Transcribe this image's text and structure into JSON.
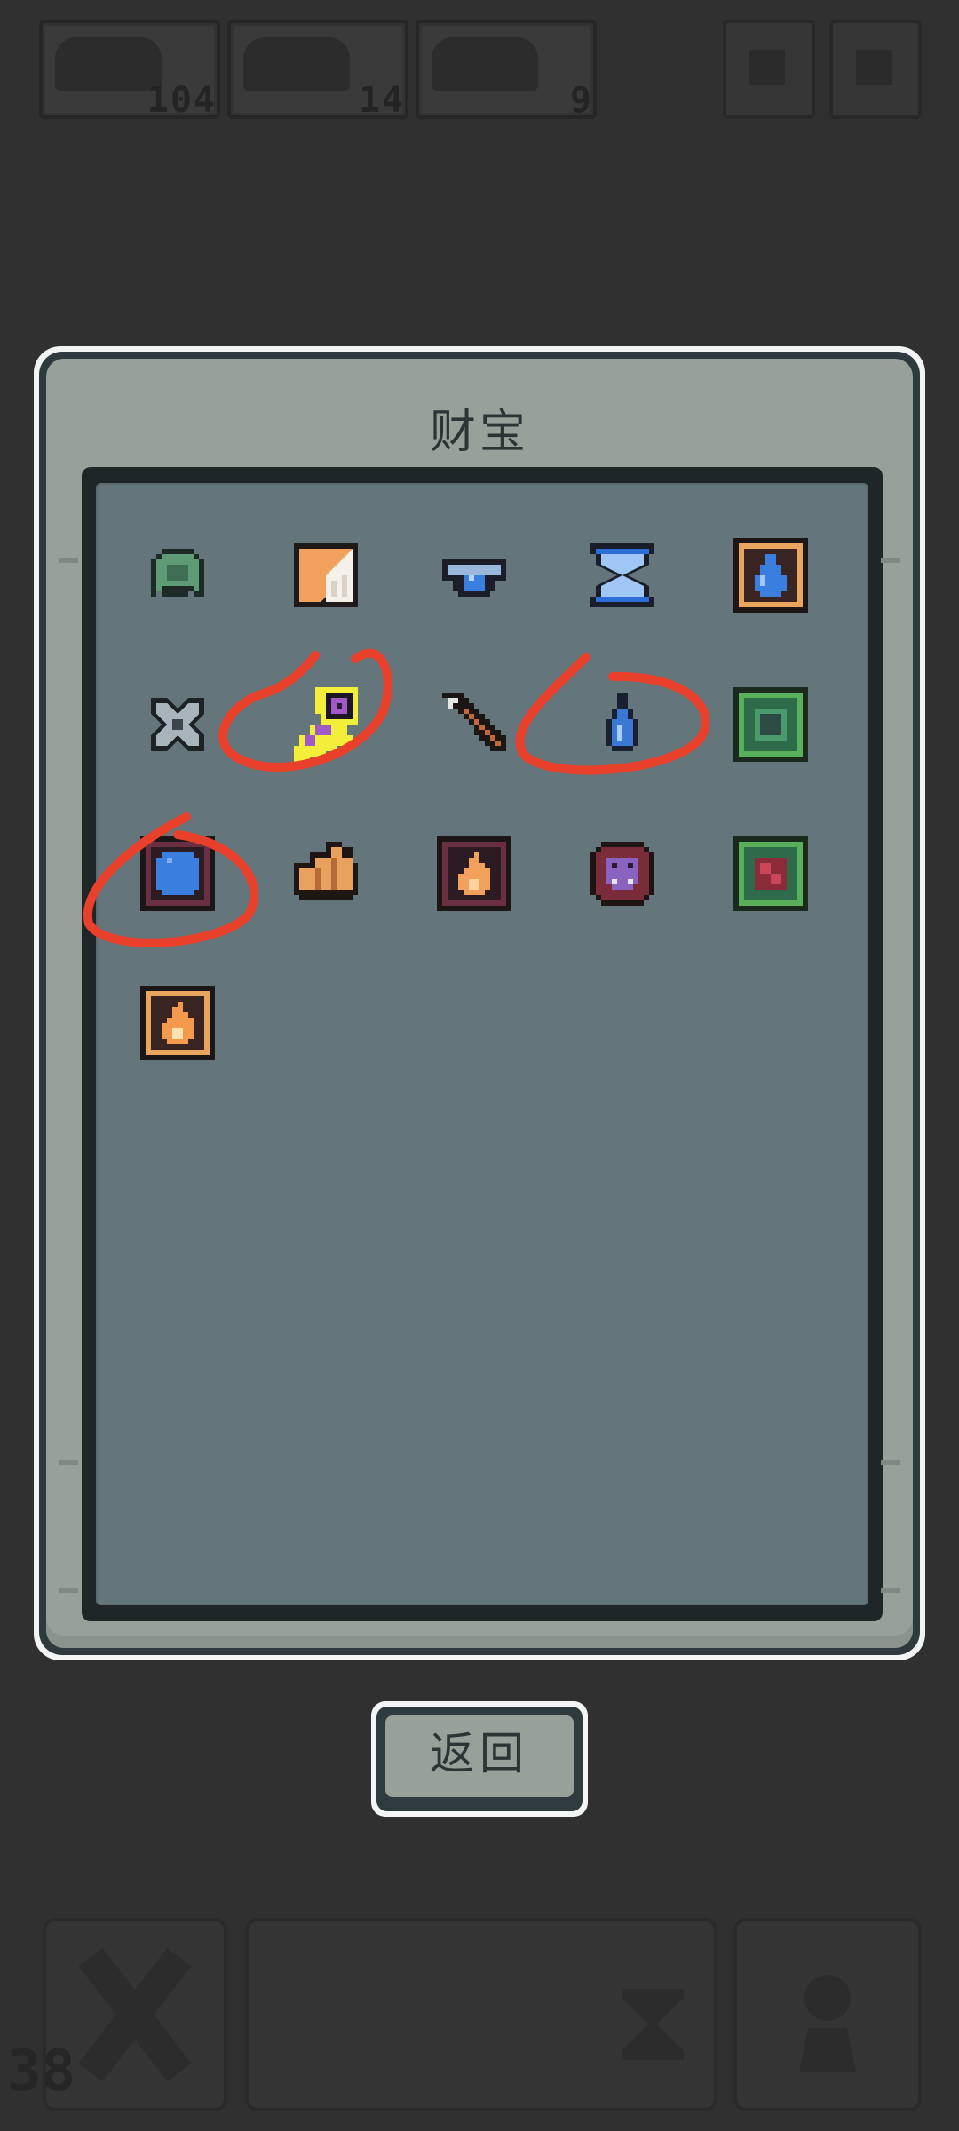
{
  "hud": {
    "resources": [
      {
        "icon": "creature-portrait-icon",
        "count": "104"
      },
      {
        "icon": "beast-portrait-icon",
        "count": "14"
      },
      {
        "icon": "crab-portrait-icon",
        "count": "9"
      }
    ],
    "buttons": [
      {
        "icon": "menu-icon"
      },
      {
        "icon": "settings-icon"
      }
    ]
  },
  "panel": {
    "title": "财宝"
  },
  "treasures": [
    {
      "name": "green-helmet-icon"
    },
    {
      "name": "orange-banner-icon"
    },
    {
      "name": "blue-amulet-icon"
    },
    {
      "name": "hourglass-icon"
    },
    {
      "name": "water-rune-card-icon"
    },
    {
      "name": "silver-shuriken-icon"
    },
    {
      "name": "purple-key-icon"
    },
    {
      "name": "arrow-icon"
    },
    {
      "name": "water-drop-icon"
    },
    {
      "name": "green-rune-card-icon"
    },
    {
      "name": "blue-orb-card-icon"
    },
    {
      "name": "croissant-icon"
    },
    {
      "name": "fire-rune-card-icon"
    },
    {
      "name": "demon-mask-icon"
    },
    {
      "name": "red-rune-card-icon"
    },
    {
      "name": "flame-card-icon"
    }
  ],
  "back_button": {
    "label": "返回"
  },
  "bottom": {
    "level": "38",
    "slots": [
      {
        "icon": "crossed-swords-icon"
      },
      {
        "icon": "hourglass-icon"
      },
      {
        "icon": "pawn-icon"
      }
    ]
  },
  "colors": {
    "background": "#303030",
    "panel": "#98a09a",
    "well": "#64757b",
    "annotation": "#e8402a"
  }
}
